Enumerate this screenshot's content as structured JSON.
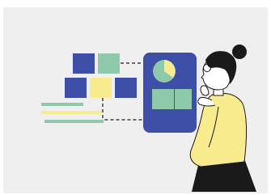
{
  "illustration": {
    "background": "#efefef",
    "colors": {
      "navy": "#3d4fa7",
      "mint": "#8fc9ac",
      "yellow": "#f9ec8e",
      "skin": "#ffffff",
      "hair": "#1a1a1a",
      "sweater": "#f9ec8e",
      "skirt": "#1a1a1a"
    },
    "icons": [
      "tile-grid-icon",
      "stacked-bars-icon",
      "dashed-connector-icon",
      "phone-dashboard-icon",
      "pie-chart-icon",
      "person-thinking-icon"
    ]
  }
}
